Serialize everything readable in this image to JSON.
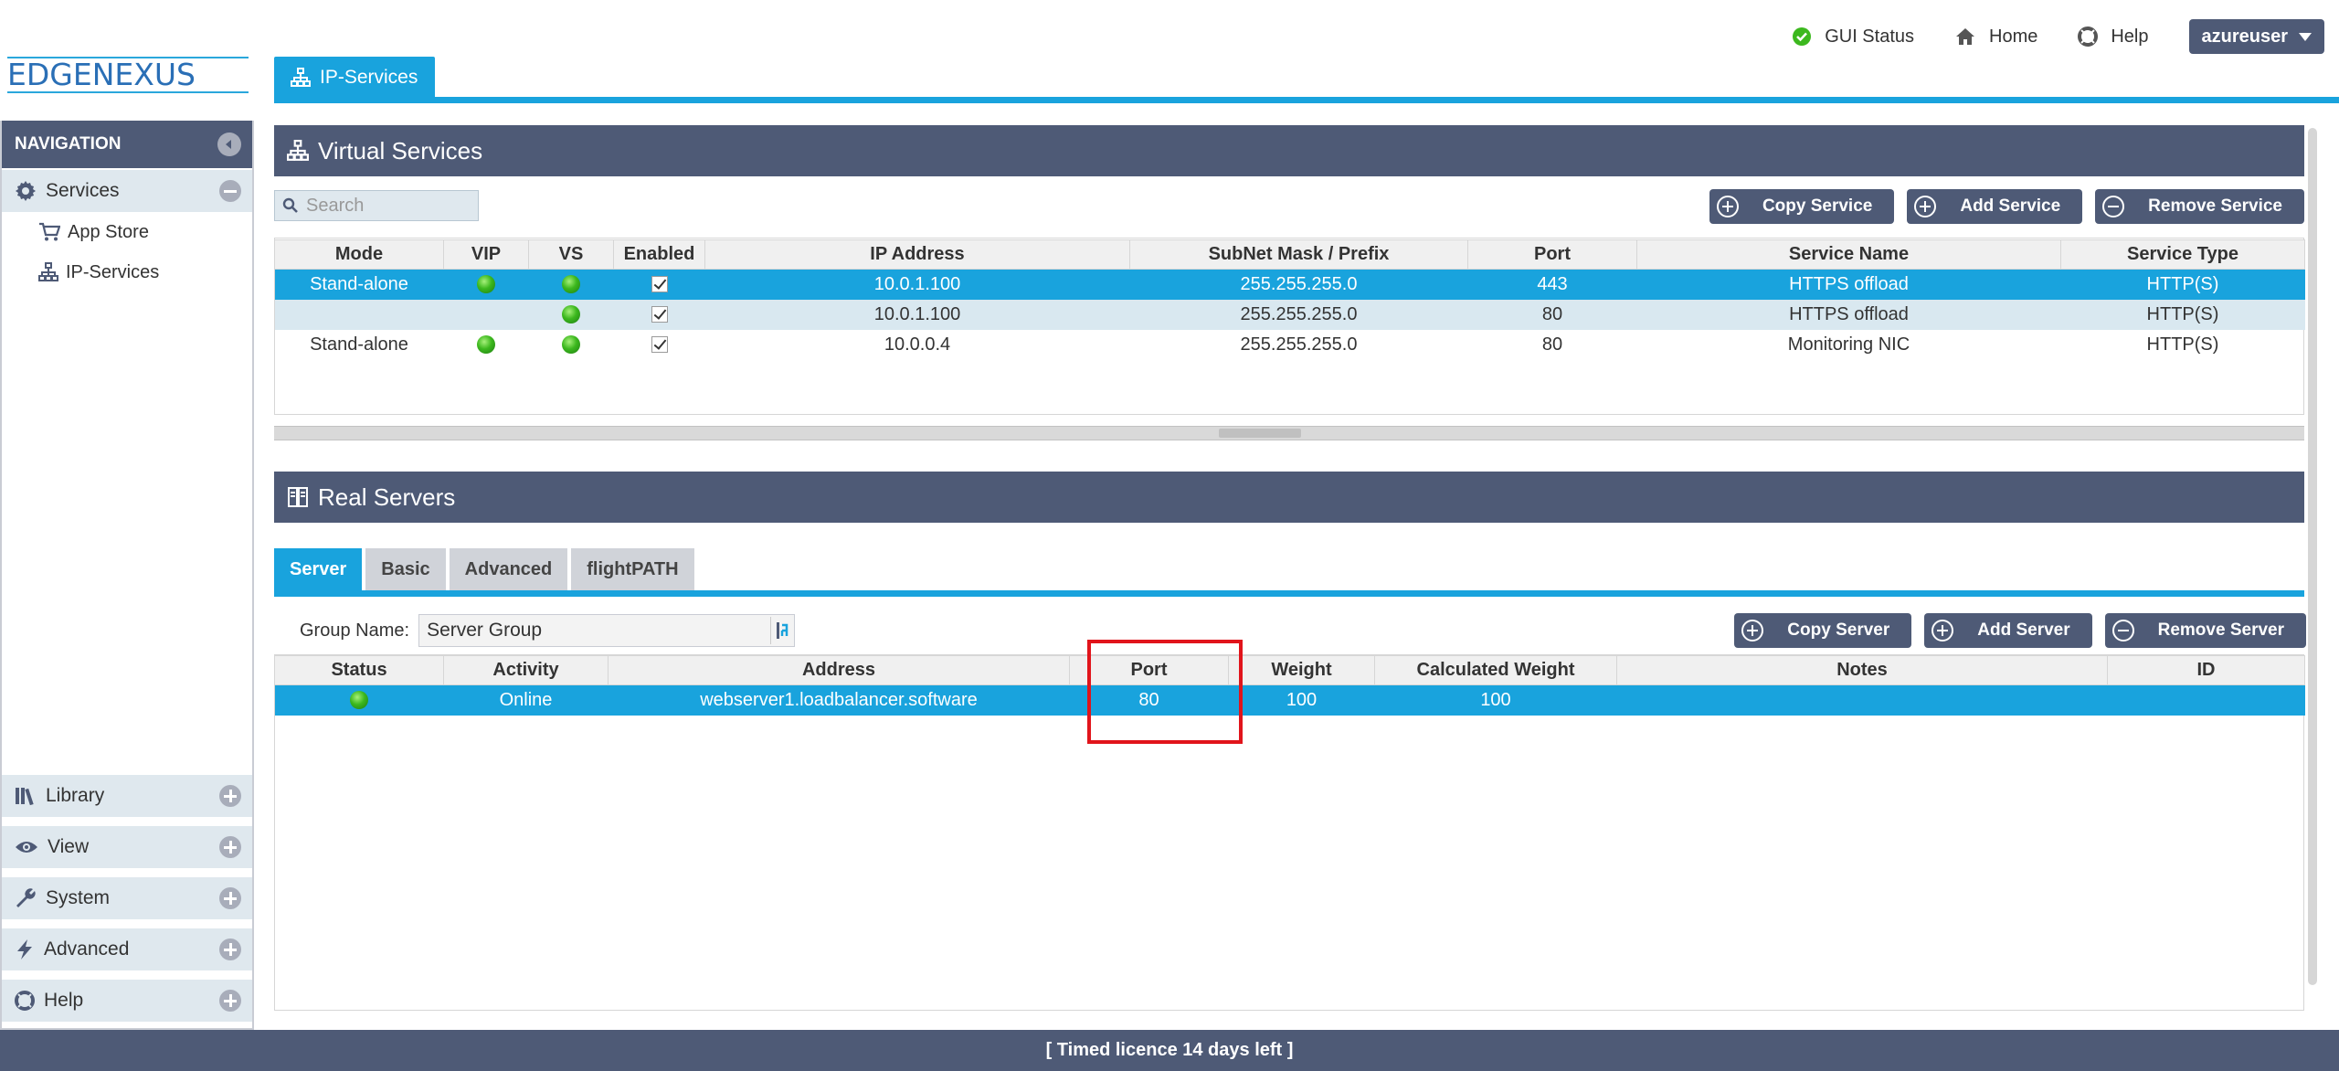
{
  "brand": {
    "logo_part1": "EDGE",
    "logo_part2": "NEXUS"
  },
  "topnav": {
    "gui_status": "GUI Status",
    "home": "Home",
    "help": "Help",
    "user": "azureuser"
  },
  "page_tab": {
    "label": "IP-Services"
  },
  "sidebar": {
    "title": "NAVIGATION",
    "services": {
      "label": "Services",
      "children": [
        {
          "label": "App Store"
        },
        {
          "label": "IP-Services"
        }
      ]
    },
    "sections": [
      {
        "label": "Library"
      },
      {
        "label": "View"
      },
      {
        "label": "System"
      },
      {
        "label": "Advanced"
      },
      {
        "label": "Help"
      }
    ]
  },
  "virtual_services": {
    "title": "Virtual Services",
    "search_placeholder": "Search",
    "buttons": {
      "copy": "Copy Service",
      "add": "Add Service",
      "remove": "Remove Service"
    },
    "columns": [
      "Mode",
      "VIP",
      "VS",
      "Enabled",
      "IP Address",
      "SubNet Mask / Prefix",
      "Port",
      "Service Name",
      "Service Type"
    ],
    "rows": [
      {
        "mode": "Stand-alone",
        "vip": true,
        "vs": true,
        "enabled": true,
        "ip": "10.0.1.100",
        "mask": "255.255.255.0",
        "port": "443",
        "name": "HTTPS offload",
        "type": "HTTP(S)"
      },
      {
        "mode": "",
        "vip": false,
        "vs": true,
        "enabled": true,
        "ip": "10.0.1.100",
        "mask": "255.255.255.0",
        "port": "80",
        "name": "HTTPS offload",
        "type": "HTTP(S)"
      },
      {
        "mode": "Stand-alone",
        "vip": true,
        "vs": true,
        "enabled": true,
        "ip": "10.0.0.4",
        "mask": "255.255.255.0",
        "port": "80",
        "name": "Monitoring NIC",
        "type": "HTTP(S)"
      }
    ]
  },
  "real_servers": {
    "title": "Real Servers",
    "tabs": [
      "Server",
      "Basic",
      "Advanced",
      "flightPATH"
    ],
    "group_label": "Group Name:",
    "group_value": "Server Group",
    "buttons": {
      "copy": "Copy Server",
      "add": "Add Server",
      "remove": "Remove Server"
    },
    "columns": [
      "Status",
      "Activity",
      "Address",
      "Port",
      "Weight",
      "Calculated Weight",
      "Notes",
      "ID"
    ],
    "rows": [
      {
        "status": true,
        "activity": "Online",
        "address": "webserver1.loadbalancer.software",
        "port": "80",
        "weight": "100",
        "calc_weight": "100",
        "notes": "",
        "id": ""
      }
    ]
  },
  "footer": {
    "text": "[ Timed licence 14 days left ]"
  },
  "colors": {
    "accent": "#19a3dd",
    "header_bg": "#4e5a76",
    "highlight_box": "#e1141b"
  }
}
